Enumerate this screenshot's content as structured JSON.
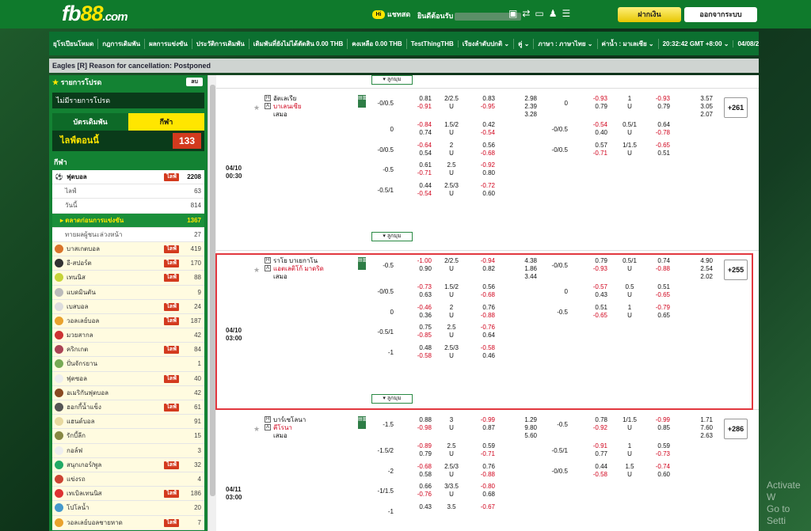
{
  "header": {
    "logo_main": "fb",
    "logo_num": "88",
    "logo_dom": ".com",
    "chat": "แชทสด",
    "welcome": "ยินดีต้อนรับ",
    "deposit": "ฝากเงิน",
    "logout": "ออกจากระบบ"
  },
  "nav": [
    "ยุโรเปียนโหมด",
    "กฎการเดิมพัน",
    "ผลการแข่งขัน",
    "ประวัติการเดิมพัน",
    "เดิมพันที่ยังไม่ได้ตัดสิน 0.00 THB",
    "คงเหลือ 0.00 THB",
    "TestThingTHB",
    "เรียงลำดับปกติ ⌄",
    "คู่ ⌄",
    "ภาษา : ภาษาไทย ⌄",
    "ค่าน้ำ : มาเลเซีย ⌄",
    "20:32:42 GMT +8:00 ⌄",
    "04/08/2023"
  ],
  "ticker": "Eagles [R] Reason for cancellation: Postponed",
  "sidebar": {
    "fav_title": "รายการโปรด",
    "del": "ลบ",
    "no_fav": "ไม่มีรายการโปรด",
    "tab_bet": "บัตรเดิมพัน",
    "tab_live": "กีฬา",
    "live_now": "ไลฟ์ตอนนี้",
    "live_count": "133",
    "sports_title": "กีฬา",
    "football": {
      "label": "ฟุตบอล",
      "live": "ไลฟ์",
      "count": "2208"
    },
    "subs": [
      {
        "label": "ไลฟ์",
        "count": "63"
      },
      {
        "label": "วันนี้",
        "count": "814"
      }
    ],
    "early": {
      "label": "ตลาดก่อนการแข่งขัน",
      "count": "1367"
    },
    "outright": {
      "label": "ทายผลผู้ชนะล่วงหน้า",
      "count": "27"
    },
    "items": [
      {
        "label": "บาสเกตบอล",
        "live": "ไลฟ์",
        "count": "419"
      },
      {
        "label": "อี-สปอร์ต",
        "live": "ไลฟ์",
        "count": "170"
      },
      {
        "label": "เทนนิส",
        "live": "ไลฟ์",
        "count": "88"
      },
      {
        "label": "แบดมินตัน",
        "live": "",
        "count": "9"
      },
      {
        "label": "เบสบอล",
        "live": "ไลฟ์",
        "count": "24"
      },
      {
        "label": "วอลเลย์บอล",
        "live": "ไลฟ์",
        "count": "187"
      },
      {
        "label": "มวยสากล",
        "live": "",
        "count": "42"
      },
      {
        "label": "คริกเกต",
        "live": "ไลฟ์",
        "count": "84"
      },
      {
        "label": "ปั่นจักรยาน",
        "live": "",
        "count": "1"
      },
      {
        "label": "ฟุตซอล",
        "live": "ไลฟ์",
        "count": "40"
      },
      {
        "label": "อเมริกันฟุตบอล",
        "live": "",
        "count": "42"
      },
      {
        "label": "ฮอกกี้น้ำแข็ง",
        "live": "ไลฟ์",
        "count": "61"
      },
      {
        "label": "แฮนด์บอล",
        "live": "",
        "count": "91"
      },
      {
        "label": "รักบี้ลีก",
        "live": "",
        "count": "15"
      },
      {
        "label": "กอล์ฟ",
        "live": "",
        "count": "3"
      },
      {
        "label": "สนุกเกอร์/พูล",
        "live": "ไลฟ์",
        "count": "32"
      },
      {
        "label": "แข่งรถ",
        "live": "",
        "count": "4"
      },
      {
        "label": "เทเบิลเทนนิส",
        "live": "ไลฟ์",
        "count": "186"
      },
      {
        "label": "โปโลน้ำ",
        "live": "",
        "count": "20"
      },
      {
        "label": "วอลเลย์บอลชายหาด",
        "live": "ไลฟ์",
        "count": "7"
      }
    ]
  },
  "collapse": "ลูกมุม",
  "draw": "เสมอ",
  "matches": [
    {
      "date": "04/10",
      "time": "00:30",
      "home": "อัตเลเรีย",
      "away": "บาเลนเซีย",
      "plus": "+261",
      "rows": [
        {
          "hdp": "-0/0.5",
          "h1": "0.81",
          "h1r": false,
          "h2": "-0.91",
          "h2r": true,
          "ou": "2/2.5",
          "u": "U",
          "o1": "0.83",
          "o1r": false,
          "o2": "-0.95",
          "o2r": true,
          "x1": "2.98",
          "x2": "2.39",
          "x3": "3.28",
          "fh": "0",
          "f1": "-0.93",
          "f1r": true,
          "f2": "0.79",
          "f2r": false,
          "fou": "1",
          "fu": "U",
          "g1": "-0.93",
          "g1r": true,
          "g2": "0.79",
          "g2r": false,
          "y1": "3.57",
          "y2": "3.05",
          "y3": "2.07"
        },
        {
          "hdp": "0",
          "h1": "-0.84",
          "h1r": true,
          "h2": "0.74",
          "h2r": false,
          "ou": "1.5/2",
          "u": "U",
          "o1": "0.42",
          "o1r": false,
          "o2": "-0.54",
          "o2r": true,
          "fh": "-0/0.5",
          "f1": "-0.54",
          "f1r": true,
          "f2": "0.40",
          "f2r": false,
          "fou": "0.5/1",
          "fu": "U",
          "g1": "0.64",
          "g1r": false,
          "g2": "-0.78",
          "g2r": true
        },
        {
          "hdp": "-0/0.5",
          "h1": "-0.64",
          "h1r": true,
          "h2": "0.54",
          "h2r": false,
          "ou": "2",
          "u": "U",
          "o1": "0.56",
          "o1r": false,
          "o2": "-0.68",
          "o2r": true,
          "fh": "-0/0.5",
          "f1": "0.57",
          "f1r": false,
          "f2": "-0.71",
          "f2r": true,
          "fou": "1/1.5",
          "fu": "U",
          "g1": "-0.65",
          "g1r": true,
          "g2": "0.51",
          "g2r": false
        },
        {
          "hdp": "-0.5",
          "h1": "0.61",
          "h1r": false,
          "h2": "-0.71",
          "h2r": true,
          "ou": "2.5",
          "u": "U",
          "o1": "-0.92",
          "o1r": true,
          "o2": "0.80",
          "o2r": false
        },
        {
          "hdp": "-0.5/1",
          "h1": "0.44",
          "h1r": false,
          "h2": "-0.54",
          "h2r": true,
          "ou": "2.5/3",
          "u": "U",
          "o1": "-0.72",
          "o1r": true,
          "o2": "0.60",
          "o2r": false
        }
      ]
    },
    {
      "date": "04/10",
      "time": "03:00",
      "home": "ราโย บาเยกาโน",
      "away": "แอตเลติโก้ มาดริด",
      "plus": "+255",
      "rows": [
        {
          "hdp": "-0.5",
          "h1": "-1.00",
          "h1r": true,
          "h2": "0.90",
          "h2r": false,
          "ou": "2/2.5",
          "u": "U",
          "o1": "-0.94",
          "o1r": true,
          "o2": "0.82",
          "o2r": false,
          "x1": "4.38",
          "x2": "1.86",
          "x3": "3.44",
          "fh": "-0/0.5",
          "f1": "0.79",
          "f1r": false,
          "f2": "-0.93",
          "f2r": true,
          "fou": "0.5/1",
          "fu": "U",
          "g1": "0.74",
          "g1r": false,
          "g2": "-0.88",
          "g2r": true,
          "y1": "4.90",
          "y2": "2.54",
          "y3": "2.02"
        },
        {
          "hdp": "-0/0.5",
          "h1": "-0.73",
          "h1r": true,
          "h2": "0.63",
          "h2r": false,
          "ou": "1.5/2",
          "u": "U",
          "o1": "0.56",
          "o1r": false,
          "o2": "-0.68",
          "o2r": true,
          "fh": "0",
          "f1": "-0.57",
          "f1r": true,
          "f2": "0.43",
          "f2r": false,
          "fou": "0.5",
          "fu": "U",
          "g1": "0.51",
          "g1r": false,
          "g2": "-0.65",
          "g2r": true
        },
        {
          "hdp": "0",
          "h1": "-0.46",
          "h1r": true,
          "h2": "0.36",
          "h2r": false,
          "ou": "2",
          "u": "U",
          "o1": "0.76",
          "o1r": false,
          "o2": "-0.88",
          "o2r": true,
          "fh": "-0.5",
          "f1": "0.51",
          "f1r": false,
          "f2": "-0.65",
          "f2r": true,
          "fou": "1",
          "fu": "U",
          "g1": "-0.79",
          "g1r": true,
          "g2": "0.65",
          "g2r": false
        },
        {
          "hdp": "-0.5/1",
          "h1": "0.75",
          "h1r": false,
          "h2": "-0.85",
          "h2r": true,
          "ou": "2.5",
          "u": "U",
          "o1": "-0.76",
          "o1r": true,
          "o2": "0.64",
          "o2r": false
        },
        {
          "hdp": "-1",
          "h1": "0.48",
          "h1r": false,
          "h2": "-0.58",
          "h2r": true,
          "ou": "2.5/3",
          "u": "U",
          "o1": "-0.58",
          "o1r": true,
          "o2": "0.46",
          "o2r": false
        }
      ]
    },
    {
      "date": "04/11",
      "time": "03:00",
      "home": "บาร์เซโลนา",
      "away": "คีโรนา",
      "plus": "+286",
      "rows": [
        {
          "hdp": "-1.5",
          "h1": "0.88",
          "h1r": false,
          "h2": "-0.98",
          "h2r": true,
          "ou": "3",
          "u": "U",
          "o1": "-0.99",
          "o1r": true,
          "o2": "0.87",
          "o2r": false,
          "x1": "1.29",
          "x2": "9.80",
          "x3": "5.60",
          "fh": "-0.5",
          "f1": "0.78",
          "f1r": false,
          "f2": "-0.92",
          "f2r": true,
          "fou": "1/1.5",
          "fu": "U",
          "g1": "-0.99",
          "g1r": true,
          "g2": "0.85",
          "g2r": false,
          "y1": "1.71",
          "y2": "7.60",
          "y3": "2.63"
        },
        {
          "hdp": "-1.5/2",
          "h1": "-0.89",
          "h1r": true,
          "h2": "0.79",
          "h2r": false,
          "ou": "2.5",
          "u": "U",
          "o1": "0.59",
          "o1r": false,
          "o2": "-0.71",
          "o2r": true,
          "fh": "-0.5/1",
          "f1": "-0.91",
          "f1r": true,
          "f2": "0.77",
          "f2r": false,
          "fou": "1",
          "fu": "U",
          "g1": "0.59",
          "g1r": false,
          "g2": "-0.73",
          "g2r": true
        },
        {
          "hdp": "-2",
          "h1": "-0.68",
          "h1r": true,
          "h2": "0.58",
          "h2r": false,
          "ou": "2.5/3",
          "u": "U",
          "o1": "0.76",
          "o1r": false,
          "o2": "-0.88",
          "o2r": true,
          "fh": "-0/0.5",
          "f1": "0.44",
          "f1r": false,
          "f2": "-0.58",
          "f2r": true,
          "fou": "1.5",
          "fu": "U",
          "g1": "-0.74",
          "g1r": true,
          "g2": "0.60",
          "g2r": false
        },
        {
          "hdp": "-1/1.5",
          "h1": "0.66",
          "h1r": false,
          "h2": "-0.76",
          "h2r": true,
          "ou": "3/3.5",
          "u": "U",
          "o1": "-0.80",
          "o1r": true,
          "o2": "0.68",
          "o2r": false
        },
        {
          "hdp": "-1",
          "h1": "0.43",
          "h1r": false,
          "h2": "",
          "h2r": false,
          "ou": "3.5",
          "u": "",
          "o1": "-0.67",
          "o1r": true,
          "o2": "",
          "o2r": false
        }
      ]
    }
  ],
  "watermark": {
    "line1": "Activate W",
    "line2": "Go to Setti"
  }
}
